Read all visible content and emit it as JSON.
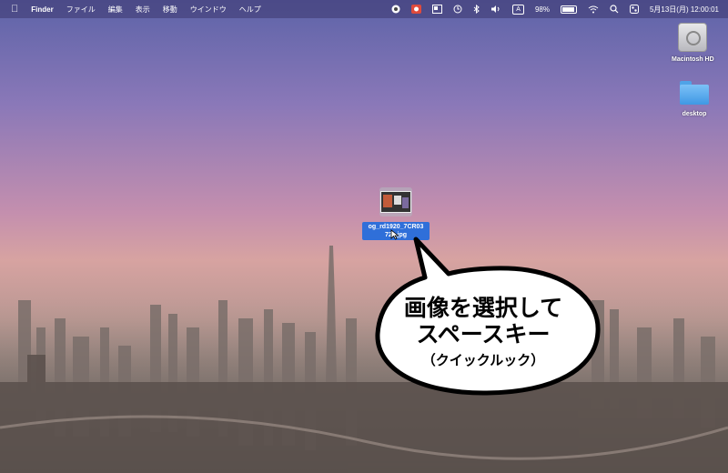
{
  "menubar": {
    "app_name": "Finder",
    "menus": [
      "ファイル",
      "編集",
      "表示",
      "移動",
      "ウインドウ",
      "ヘルプ"
    ],
    "input_indicator": "A",
    "battery_percent": "98%",
    "battery_level": 0.98,
    "datetime": "5月13日(月) 12:00:01"
  },
  "desktop": {
    "icons": [
      {
        "label": "Macintosh HD",
        "icon": "hard-drive-icon"
      },
      {
        "label": "desktop",
        "icon": "folder-icon"
      }
    ]
  },
  "selected_file": {
    "name_line1": "og_rd1920_7CR03",
    "name_line2": "72...jpg"
  },
  "callout": {
    "line1": "画像を選択して",
    "line2": "スペースキー",
    "line3": "（クイックルック）"
  }
}
